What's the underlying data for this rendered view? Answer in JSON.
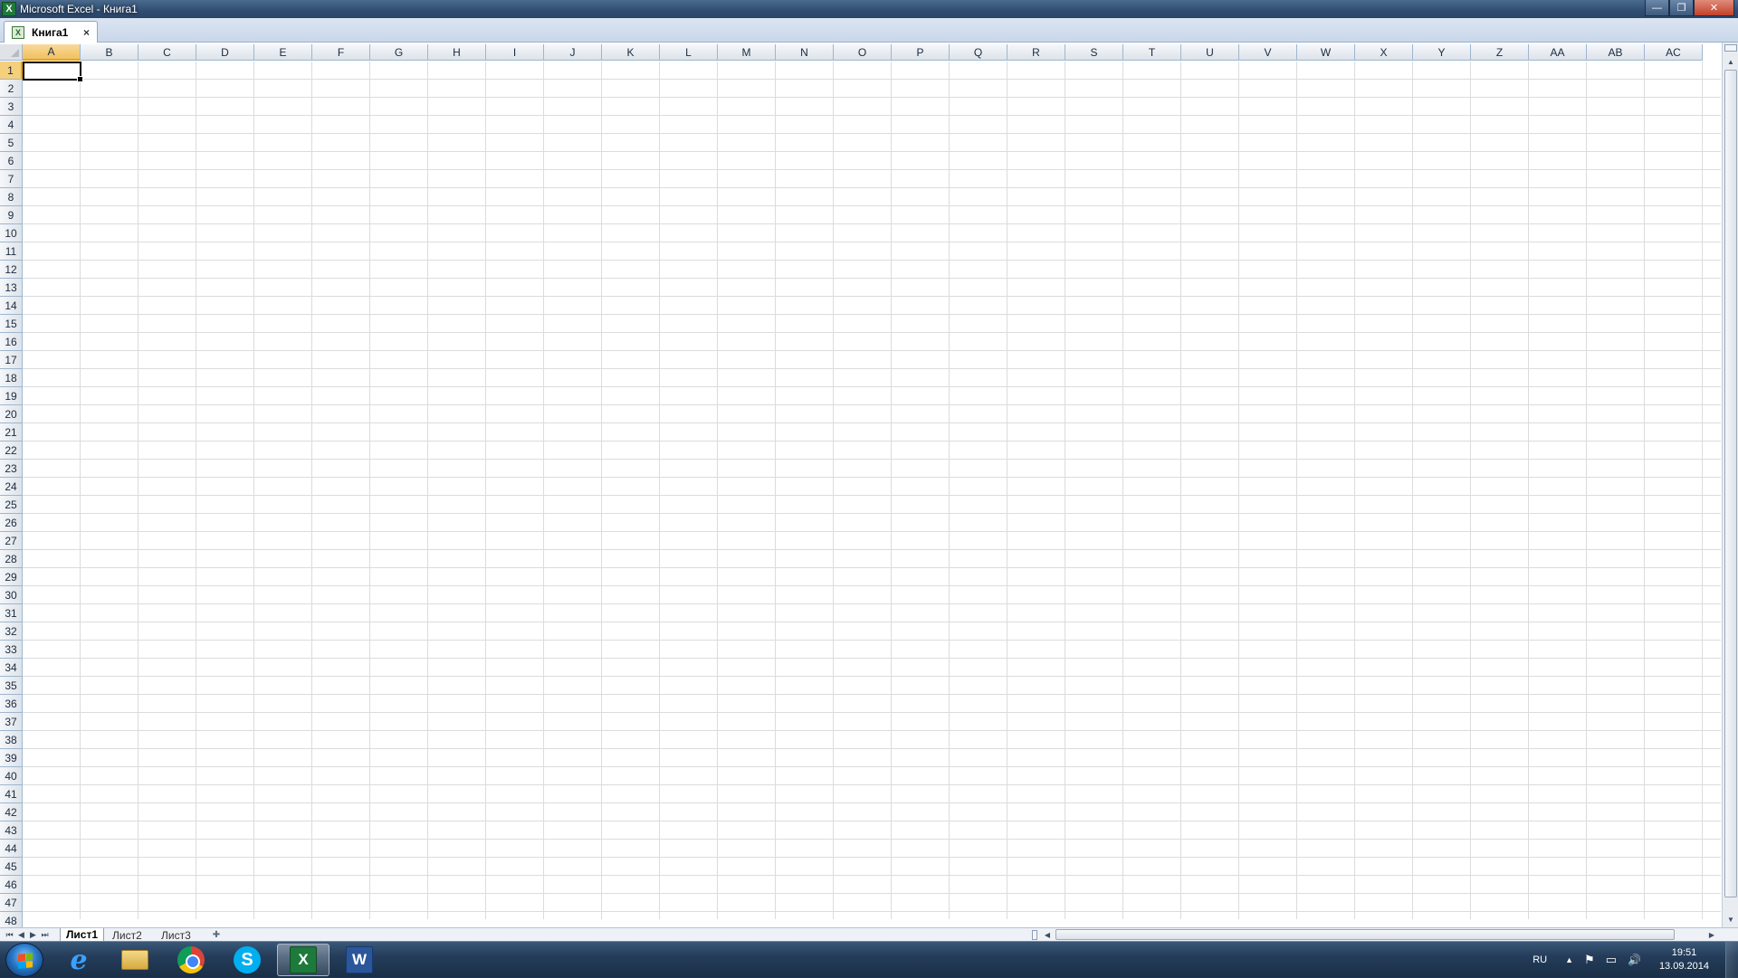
{
  "window": {
    "title": "Microsoft Excel - Книга1",
    "app_icon_glyph": "X",
    "minimize_glyph": "—",
    "restore_glyph": "❐",
    "close_glyph": "✕"
  },
  "document_tab": {
    "label": "Книга1",
    "close_glyph": "×",
    "icon_glyph": "X"
  },
  "grid": {
    "columns": [
      "A",
      "B",
      "C",
      "D",
      "E",
      "F",
      "G",
      "H",
      "I",
      "J",
      "K",
      "L",
      "M",
      "N",
      "O",
      "P",
      "Q",
      "R",
      "S",
      "T",
      "U",
      "V",
      "W",
      "X",
      "Y",
      "Z",
      "AA",
      "AB",
      "AC"
    ],
    "rows": [
      "1",
      "2",
      "3",
      "4",
      "5",
      "6",
      "7",
      "8",
      "9",
      "10",
      "11",
      "12",
      "13",
      "14",
      "15",
      "16",
      "17",
      "18",
      "19",
      "20",
      "21",
      "22",
      "23",
      "24",
      "25",
      "26",
      "27",
      "28",
      "29",
      "30",
      "31",
      "32",
      "33",
      "34",
      "35",
      "36",
      "37",
      "38",
      "39",
      "40",
      "41",
      "42",
      "43",
      "44",
      "45",
      "46",
      "47",
      "48"
    ],
    "active_cell": "A1",
    "active_column": "A",
    "active_row": "1"
  },
  "sheets": {
    "tabs": [
      "Лист1",
      "Лист2",
      "Лист3"
    ],
    "active": "Лист1",
    "nav_glyphs": [
      "⏮",
      "◀",
      "▶",
      "⏭"
    ],
    "new_sheet_glyph": "✚"
  },
  "scrollbars": {
    "up_glyph": "▲",
    "down_glyph": "▼",
    "left_glyph": "◀",
    "right_glyph": "▶"
  },
  "taskbar": {
    "apps": [
      {
        "name": "ie",
        "glyph": "e",
        "active": false
      },
      {
        "name": "explorer",
        "glyph": "",
        "active": false
      },
      {
        "name": "chrome",
        "glyph": "",
        "active": false
      },
      {
        "name": "skype",
        "glyph": "S",
        "active": false
      },
      {
        "name": "excel",
        "glyph": "X",
        "active": true
      },
      {
        "name": "word",
        "glyph": "W",
        "active": false
      }
    ],
    "language": "RU",
    "tray_glyphs": {
      "show_hidden": "▲",
      "flag": "⚑",
      "network": "▭",
      "volume": "🔊"
    },
    "time": "19:51",
    "date": "13.09.2014"
  },
  "colors": {
    "header_active": "#f6cf7c",
    "gridline": "#dadcdd",
    "excel_green": "#1e7a3a",
    "word_blue": "#2b579a"
  }
}
